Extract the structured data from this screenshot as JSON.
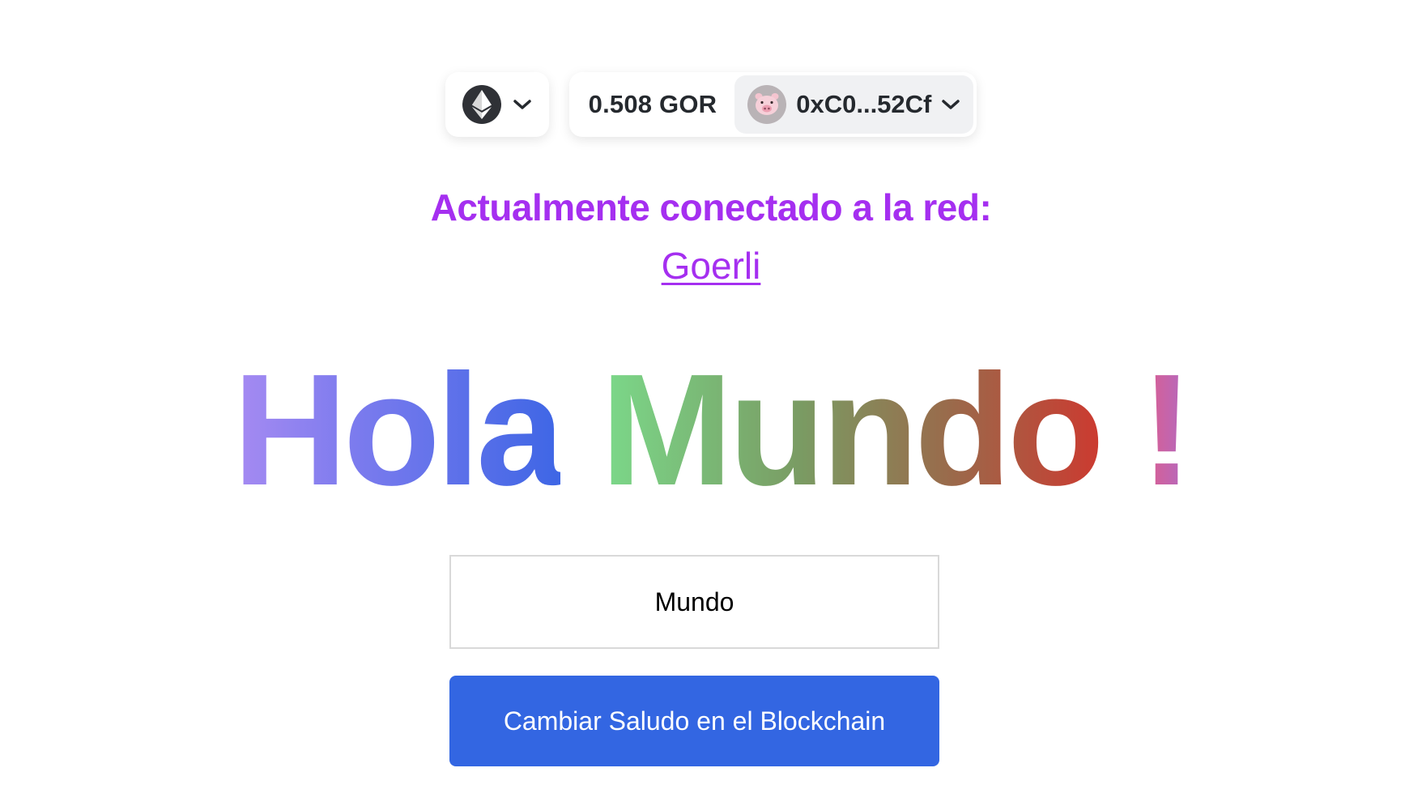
{
  "wallet": {
    "chain_icon": "ethereum-icon",
    "balance": "0.508 GOR",
    "avatar_icon": "pig-avatar-icon",
    "address": "0xC0...52Cf"
  },
  "network": {
    "heading": "Actualmente conectado a la red:",
    "name": "Goerli"
  },
  "greeting": {
    "hello": "Hola",
    "name": "Mundo",
    "bang": "!"
  },
  "form": {
    "input_value": "Mundo",
    "submit_label": "Cambiar Saludo en el Blockchain"
  },
  "colors": {
    "accent_purple": "#a52ff0",
    "button_blue": "#3366e2"
  }
}
